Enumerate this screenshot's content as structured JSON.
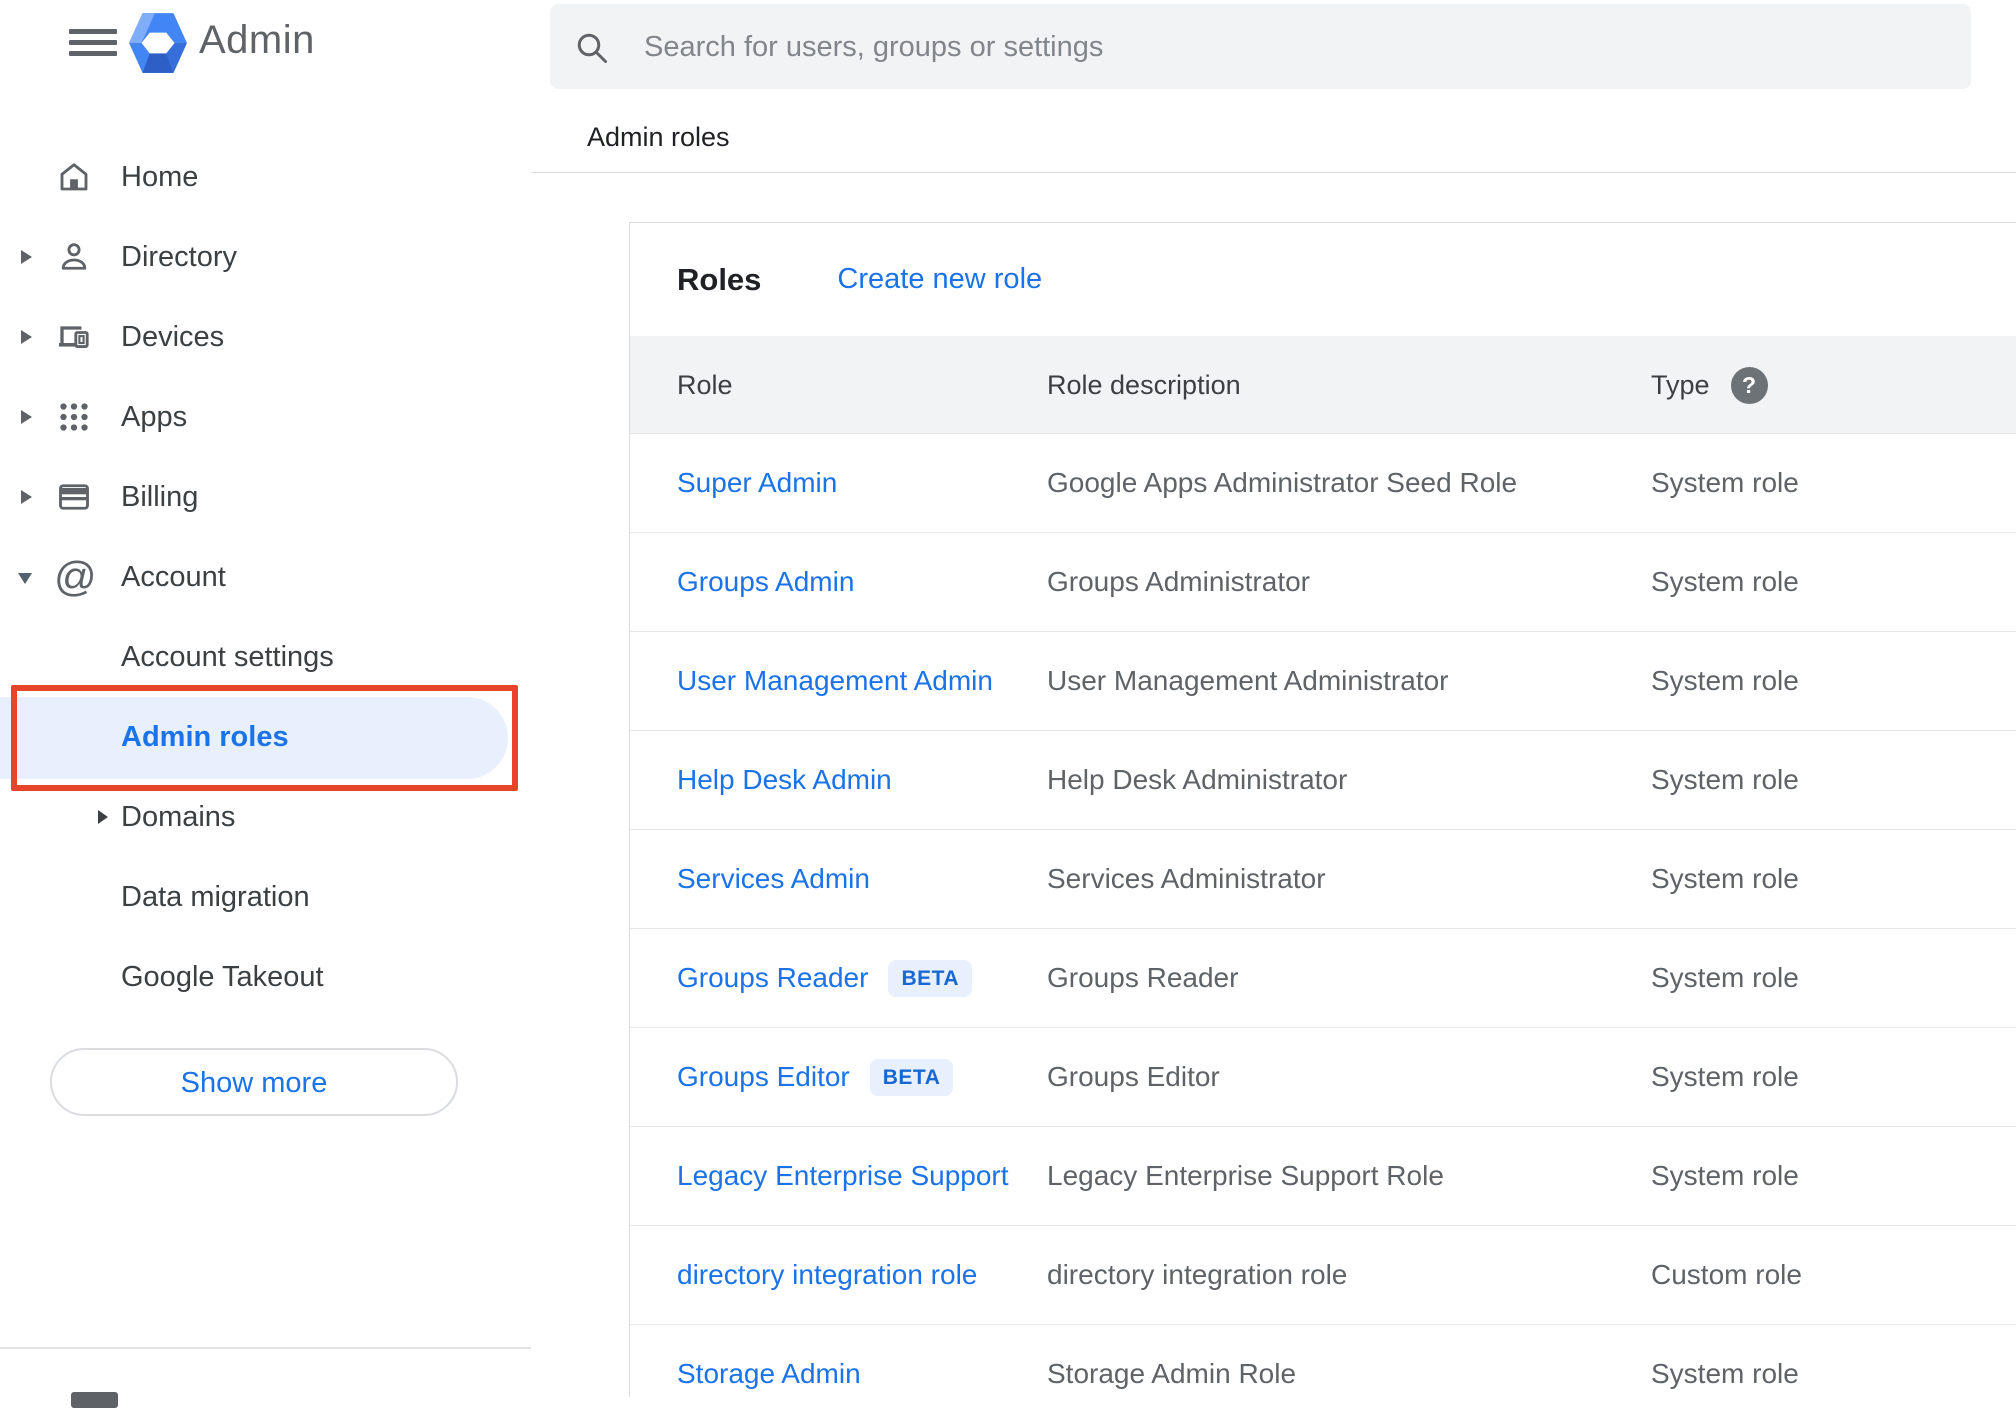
{
  "header": {
    "app_name": "Admin",
    "search_placeholder": "Search for users, groups or settings"
  },
  "breadcrumb": {
    "label": "Admin roles"
  },
  "sidebar": {
    "items": [
      {
        "label": "Home",
        "icon": "home",
        "expandable": false
      },
      {
        "label": "Directory",
        "icon": "person",
        "expandable": true
      },
      {
        "label": "Devices",
        "icon": "devices",
        "expandable": true
      },
      {
        "label": "Apps",
        "icon": "apps-grid",
        "expandable": true
      },
      {
        "label": "Billing",
        "icon": "card",
        "expandable": true
      },
      {
        "label": "Account",
        "icon": "at-sign",
        "expandable": true,
        "expanded": true
      }
    ],
    "sub_items": [
      {
        "label": "Account settings",
        "active": false
      },
      {
        "label": "Admin roles",
        "active": true,
        "annotated": true
      },
      {
        "label": "Domains",
        "active": false,
        "expandable": true
      },
      {
        "label": "Data migration",
        "active": false
      },
      {
        "label": "Google Takeout",
        "active": false
      }
    ],
    "show_more_label": "Show more"
  },
  "roles_panel": {
    "title": "Roles",
    "create_link_label": "Create new role",
    "columns": {
      "role": "Role",
      "description": "Role description",
      "type": "Type"
    },
    "type_help_glyph": "?",
    "beta_label": "BETA",
    "rows": [
      {
        "role": "Super Admin",
        "beta": false,
        "description": "Google Apps Administrator Seed Role",
        "type": "System role"
      },
      {
        "role": "Groups Admin",
        "beta": false,
        "description": "Groups Administrator",
        "type": "System role"
      },
      {
        "role": "User Management Admin",
        "beta": false,
        "description": "User Management Administrator",
        "type": "System role"
      },
      {
        "role": "Help Desk Admin",
        "beta": false,
        "description": "Help Desk Administrator",
        "type": "System role"
      },
      {
        "role": "Services Admin",
        "beta": false,
        "description": "Services Administrator",
        "type": "System role"
      },
      {
        "role": "Groups Reader",
        "beta": true,
        "description": "Groups Reader",
        "type": "System role"
      },
      {
        "role": "Groups Editor",
        "beta": true,
        "description": "Groups Editor",
        "type": "System role"
      },
      {
        "role": "Legacy Enterprise Support",
        "beta": false,
        "description": "Legacy Enterprise Support Role",
        "type": "System role"
      },
      {
        "role": "directory integration role",
        "beta": false,
        "description": "directory integration role",
        "type": "Custom role"
      },
      {
        "role": "Storage Admin",
        "beta": false,
        "description": "Storage Admin Role",
        "type": "System role"
      }
    ]
  },
  "colors": {
    "accent_blue": "#1a73e8",
    "active_item_bg": "#e8f0fe",
    "annotation_red": "#e8442a",
    "beta_badge_text": "#1967d2",
    "header_band_bg": "#f1f3f4"
  }
}
